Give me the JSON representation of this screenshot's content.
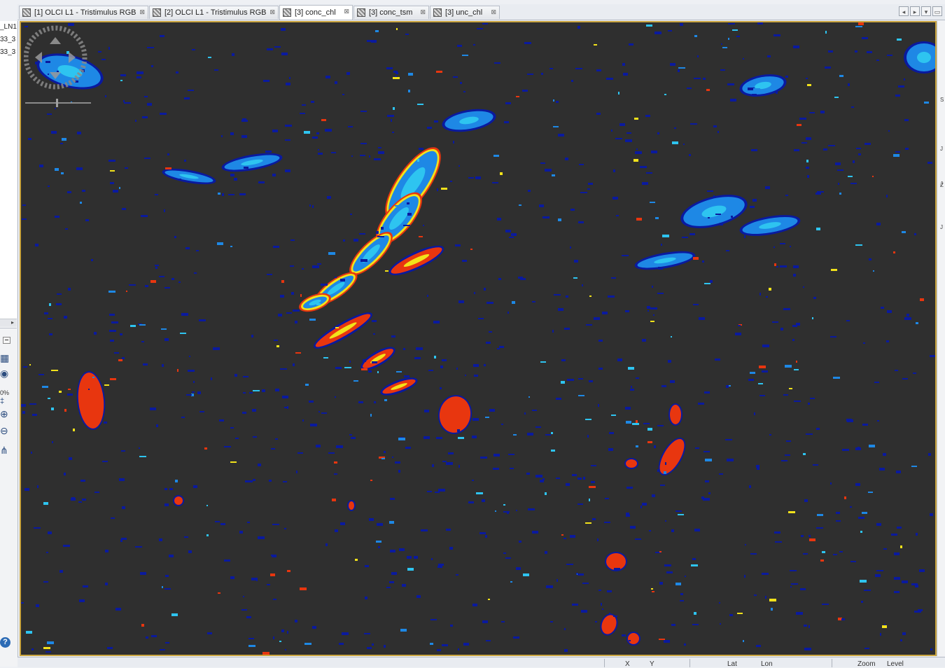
{
  "tabs": [
    {
      "label": "[1] OLCI L1 - Tristimulus RGB",
      "active": false
    },
    {
      "label": "[2] OLCI L1 - Tristimulus RGB",
      "active": false
    },
    {
      "label": "[3] conc_chl",
      "active": true
    },
    {
      "label": "[3] conc_tsm",
      "active": false
    },
    {
      "label": "[3] unc_chl",
      "active": false
    }
  ],
  "tab_close_glyph": "⊠",
  "product_tree": {
    "items": [
      "_LN1",
      "33_3",
      "33_3"
    ]
  },
  "navigation": {
    "zoom_text": "0%"
  },
  "right_panel_marks": [
    "S",
    "J",
    "J",
    "Z",
    "J"
  ],
  "status": {
    "x_label": "X",
    "y_label": "Y",
    "lat_label": "Lat",
    "lon_label": "Lon",
    "zoom_label": "Zoom",
    "level_label": "Level"
  },
  "colors": {
    "image_background": "#2f2f2f",
    "view_border": "#c9a43e",
    "palette_low": "#0a1a9e",
    "palette_mid_low": "#1e88e5",
    "palette_mid": "#2ec4f0",
    "palette_mid_high": "#f2e21b",
    "palette_high": "#e8360f"
  }
}
